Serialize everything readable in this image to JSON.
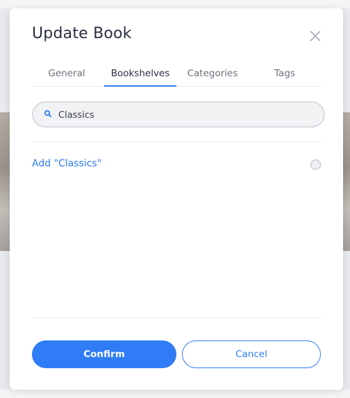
{
  "modal": {
    "title": "Update Book",
    "tabs": [
      {
        "label": "General"
      },
      {
        "label": "Bookshelves"
      },
      {
        "label": "Categories"
      },
      {
        "label": "Tags"
      }
    ],
    "active_tab": "Bookshelves",
    "search": {
      "value": "Classics",
      "icon": "search-icon"
    },
    "add_option_label": "Add \"Classics\"",
    "confirm_label": "Confirm",
    "cancel_label": "Cancel",
    "close_icon": "close-icon"
  },
  "colors": {
    "accent": "#2f7cf6",
    "title": "#2a2e40",
    "tab_inactive": "#6b6f7b",
    "background": "#e9eaee"
  }
}
